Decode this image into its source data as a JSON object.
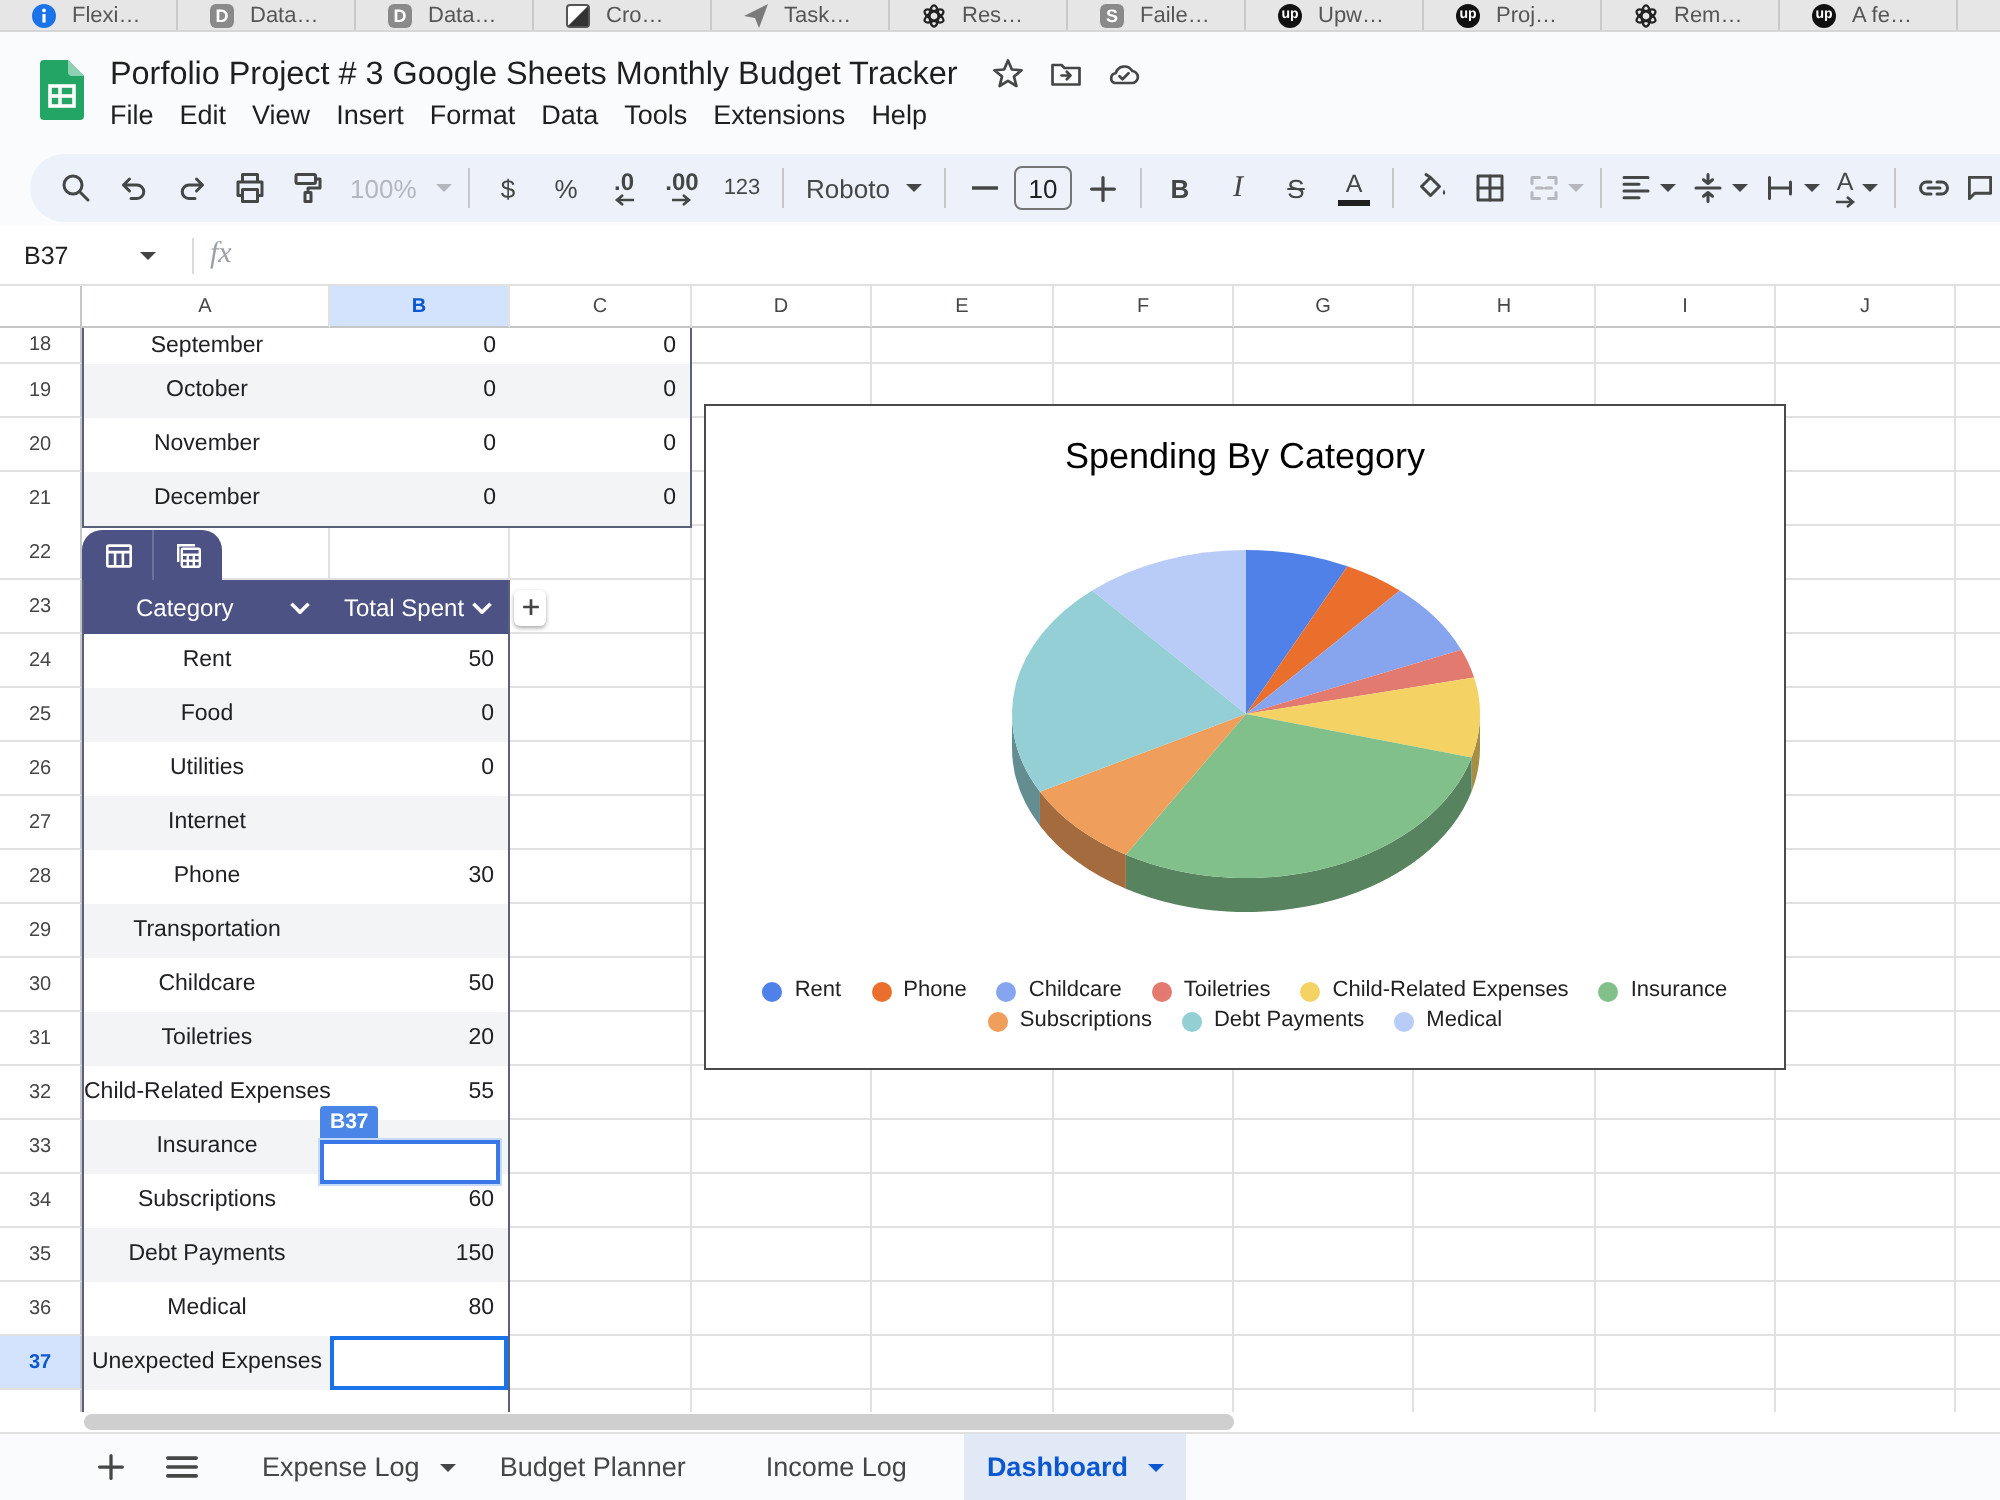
{
  "browser_tabs": [
    {
      "title": "Flexi…",
      "kind": "info"
    },
    {
      "title": "Data…",
      "kind": "letter",
      "badge": "D"
    },
    {
      "title": "Data…",
      "kind": "letter",
      "badge": "D"
    },
    {
      "title": "Cro…",
      "kind": "slash"
    },
    {
      "title": "Task…",
      "kind": "plane"
    },
    {
      "title": "Res…",
      "kind": "knot"
    },
    {
      "title": "Faile…",
      "kind": "letter",
      "badge": "S"
    },
    {
      "title": "Upw…",
      "kind": "round-letter",
      "badge": "up"
    },
    {
      "title": "Proj…",
      "kind": "round-letter",
      "badge": "up"
    },
    {
      "title": "Rem…",
      "kind": "knot"
    },
    {
      "title": "A fe…",
      "kind": "round-letter",
      "badge": "up"
    }
  ],
  "document": {
    "title": "Porfolio Project # 3 Google Sheets Monthly Budget Tracker",
    "menu": [
      "File",
      "Edit",
      "View",
      "Insert",
      "Format",
      "Data",
      "Tools",
      "Extensions",
      "Help"
    ]
  },
  "toolbar": {
    "zoom": {
      "label": "100%",
      "disabled": true
    },
    "currency": "$",
    "percent": "%",
    "decrease_decimals": ".0",
    "increase_decimals": ".00",
    "number_format": "123",
    "font": "Roboto",
    "font_size": "10",
    "bold": "B",
    "italic": "I",
    "strikethrough": "S",
    "text_color": "A",
    "merge": {
      "disabled": true
    },
    "text_rotation": "A"
  },
  "formula_bar": {
    "name_box": "B37",
    "function_label": "fx"
  },
  "sheet": {
    "columns": [
      {
        "label": "A",
        "selected": false
      },
      {
        "label": "B",
        "selected": true
      },
      {
        "label": "C",
        "selected": false
      },
      {
        "label": "D",
        "selected": false
      },
      {
        "label": "E",
        "selected": false
      },
      {
        "label": "F",
        "selected": false
      },
      {
        "label": "G",
        "selected": false
      },
      {
        "label": "H",
        "selected": false
      },
      {
        "label": "I",
        "selected": false
      },
      {
        "label": "J",
        "selected": false
      }
    ],
    "rows": [
      {
        "number": "18",
        "selected": false,
        "kind": "month",
        "cells": [
          "September",
          "0",
          "0"
        ]
      },
      {
        "number": "19",
        "selected": false,
        "kind": "month",
        "cells": [
          "October",
          "0",
          "0"
        ]
      },
      {
        "number": "20",
        "selected": false,
        "kind": "month",
        "cells": [
          "November",
          "0",
          "0"
        ]
      },
      {
        "number": "21",
        "selected": false,
        "kind": "month",
        "cells": [
          "December",
          "0",
          "0"
        ]
      },
      {
        "number": "22",
        "selected": false,
        "kind": "table-tab"
      },
      {
        "number": "23",
        "selected": false,
        "kind": "table-header",
        "cells": [
          "Category",
          "Total Spent"
        ]
      },
      {
        "number": "24",
        "selected": false,
        "kind": "category",
        "cells": [
          "Rent",
          "50"
        ]
      },
      {
        "number": "25",
        "selected": false,
        "kind": "category",
        "cells": [
          "Food",
          "0"
        ]
      },
      {
        "number": "26",
        "selected": false,
        "kind": "category",
        "cells": [
          "Utilities",
          "0"
        ]
      },
      {
        "number": "27",
        "selected": false,
        "kind": "category",
        "cells": [
          "Internet"
        ]
      },
      {
        "number": "28",
        "selected": false,
        "kind": "category",
        "cells": [
          "Phone",
          "30"
        ]
      },
      {
        "number": "29",
        "selected": false,
        "kind": "category",
        "cells": [
          "Transportation"
        ]
      },
      {
        "number": "30",
        "selected": false,
        "kind": "category",
        "cells": [
          "Childcare",
          "50"
        ]
      },
      {
        "number": "31",
        "selected": false,
        "kind": "category",
        "cells": [
          "Toiletries",
          "20"
        ]
      },
      {
        "number": "32",
        "selected": false,
        "kind": "category",
        "cells": [
          "Child-Related Expenses",
          "55"
        ]
      },
      {
        "number": "33",
        "selected": false,
        "kind": "category",
        "cells": [
          "Insurance"
        ]
      },
      {
        "number": "34",
        "selected": false,
        "kind": "category",
        "cells": [
          "Subscriptions",
          "60"
        ]
      },
      {
        "number": "35",
        "selected": false,
        "kind": "category",
        "cells": [
          "Debt Payments",
          "150"
        ]
      },
      {
        "number": "36",
        "selected": false,
        "kind": "category",
        "cells": [
          "Medical",
          "80"
        ]
      },
      {
        "number": "37",
        "selected": true,
        "kind": "category",
        "cells": [
          "Unexpected Expenses"
        ]
      }
    ],
    "drag_label": "B37"
  },
  "chart": {
    "title": "Spending By Category",
    "legend": [
      {
        "label": "Rent",
        "color": "#4f81e8"
      },
      {
        "label": "Phone",
        "color": "#eb6f2c"
      },
      {
        "label": "Childcare",
        "color": "#87a5ef"
      },
      {
        "label": "Toiletries",
        "color": "#e27a70"
      },
      {
        "label": "Child-Related Expenses",
        "color": "#f4d263"
      },
      {
        "label": "Insurance",
        "color": "#82c08b"
      },
      {
        "label": "Subscriptions",
        "color": "#f09e5b"
      },
      {
        "label": "Debt Payments",
        "color": "#93cfd5"
      },
      {
        "label": "Medical",
        "color": "#b9cbf7"
      }
    ]
  },
  "sheet_tabs": [
    {
      "label": "Expense Log",
      "selected": false,
      "menu_caret": true
    },
    {
      "label": "Budget Planner",
      "selected": false,
      "menu_caret": false
    },
    {
      "label": "Income Log",
      "selected": false,
      "menu_caret": false
    },
    {
      "label": "Dashboard",
      "selected": true,
      "menu_caret": true
    }
  ]
}
